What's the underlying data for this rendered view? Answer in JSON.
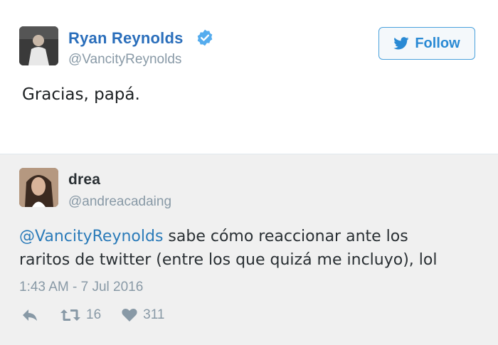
{
  "tweet": {
    "author": {
      "name": "Ryan Reynolds",
      "handle": "@VancityReynolds"
    },
    "follow_label": "Follow",
    "text": "Gracias, papá."
  },
  "reply": {
    "author": {
      "name": "drea",
      "handle": "@andreacadaing"
    },
    "mention": "@VancityReynolds",
    "text_line1": " sabe cómo reaccionar ante los",
    "text_line2": "raritos de twitter (entre los que quizá me incluyo), lol",
    "timestamp": "1:43 AM - 7 Jul 2016",
    "retweets": "16",
    "likes": "311"
  },
  "colors": {
    "brand_blue": "#2a6ebb",
    "follow_blue": "#2a8ad4",
    "muted": "#8899a6",
    "reply_background": "#f0f0f0"
  },
  "icons": {
    "verified": "verified-badge-icon",
    "follow": "twitter-bird-icon",
    "reply": "reply-arrow-icon",
    "retweet": "retweet-icon",
    "like": "heart-icon"
  }
}
